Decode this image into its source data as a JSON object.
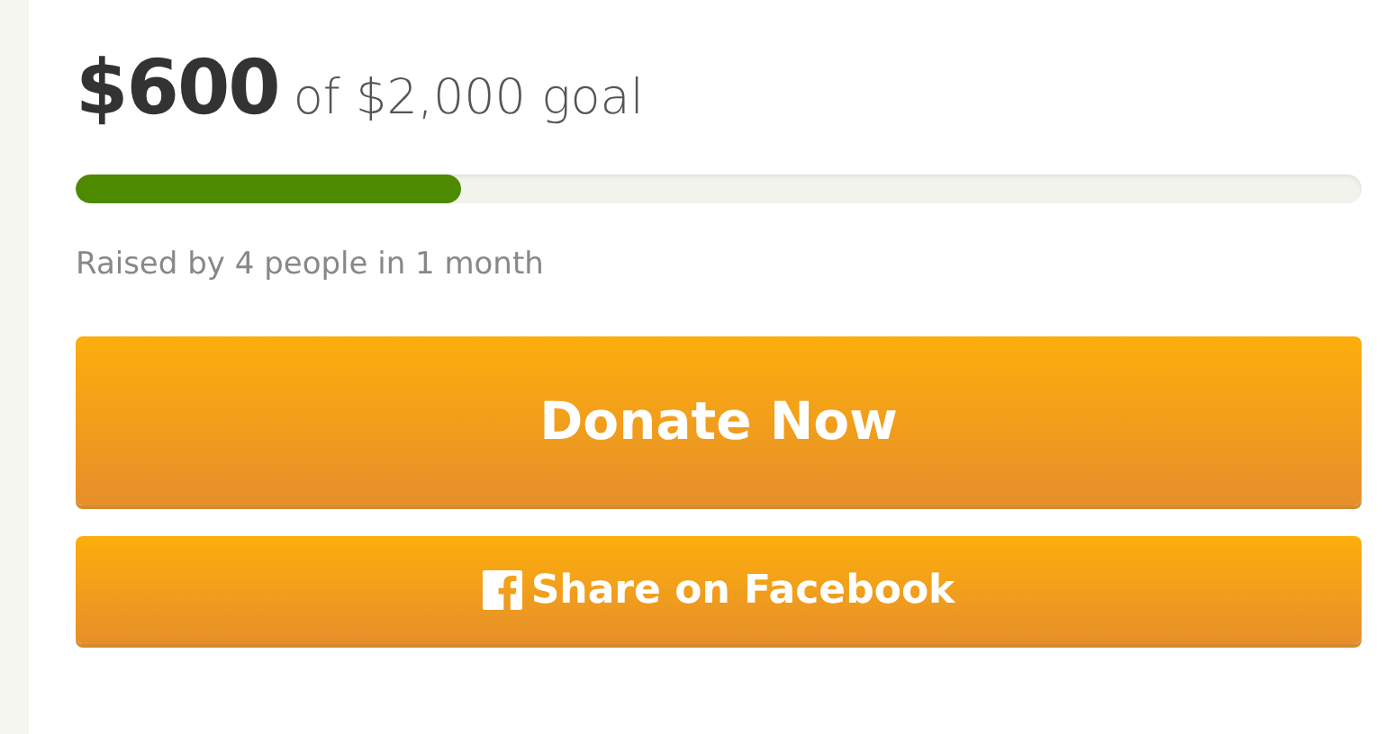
{
  "amount": "$600",
  "goal_text": "of $2,000 goal",
  "progress": {
    "level": 0.3
  },
  "raised_text": "Raised by 4 people in 1 month",
  "buttons": [
    {
      "kind": "primary",
      "label": "Donate Now"
    },
    {
      "kind": "facebook",
      "label": "Share on Facebook"
    }
  ]
}
